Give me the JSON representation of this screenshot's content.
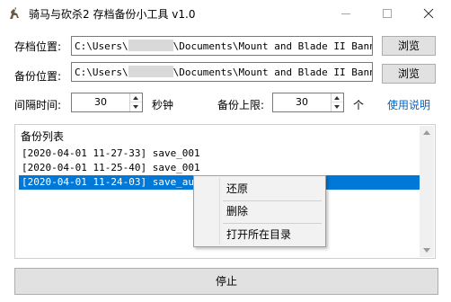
{
  "window": {
    "title": "骑马与砍杀2 存档备份小工具 v1.0"
  },
  "save_path": {
    "label": "存档位置:",
    "value_prefix": "C:\\Users\\",
    "value_suffix": "\\Documents\\Mount and Blade II Bannerlord\\",
    "browse_label": "浏览"
  },
  "backup_path": {
    "label": "备份位置:",
    "value_prefix": "C:\\Users\\",
    "value_suffix": "\\Documents\\Mount and Blade II Bannerlord\\",
    "browse_label": "浏览"
  },
  "interval": {
    "label": "间隔时间:",
    "value": "30",
    "unit": "秒钟"
  },
  "limit": {
    "label": "备份上限:",
    "value": "30",
    "unit": "个"
  },
  "help_link": "使用说明",
  "backup_list": {
    "title": "备份列表",
    "items": [
      "[2020-04-01 11-27-33] save_001",
      "[2020-04-01 11-25-40] save_001",
      "[2020-04-01 11-24-03] save_auto"
    ],
    "selected_index": 2
  },
  "context_menu": {
    "items": [
      "还原",
      "删除",
      "打开所在目录"
    ]
  },
  "stop_button": "停止"
}
